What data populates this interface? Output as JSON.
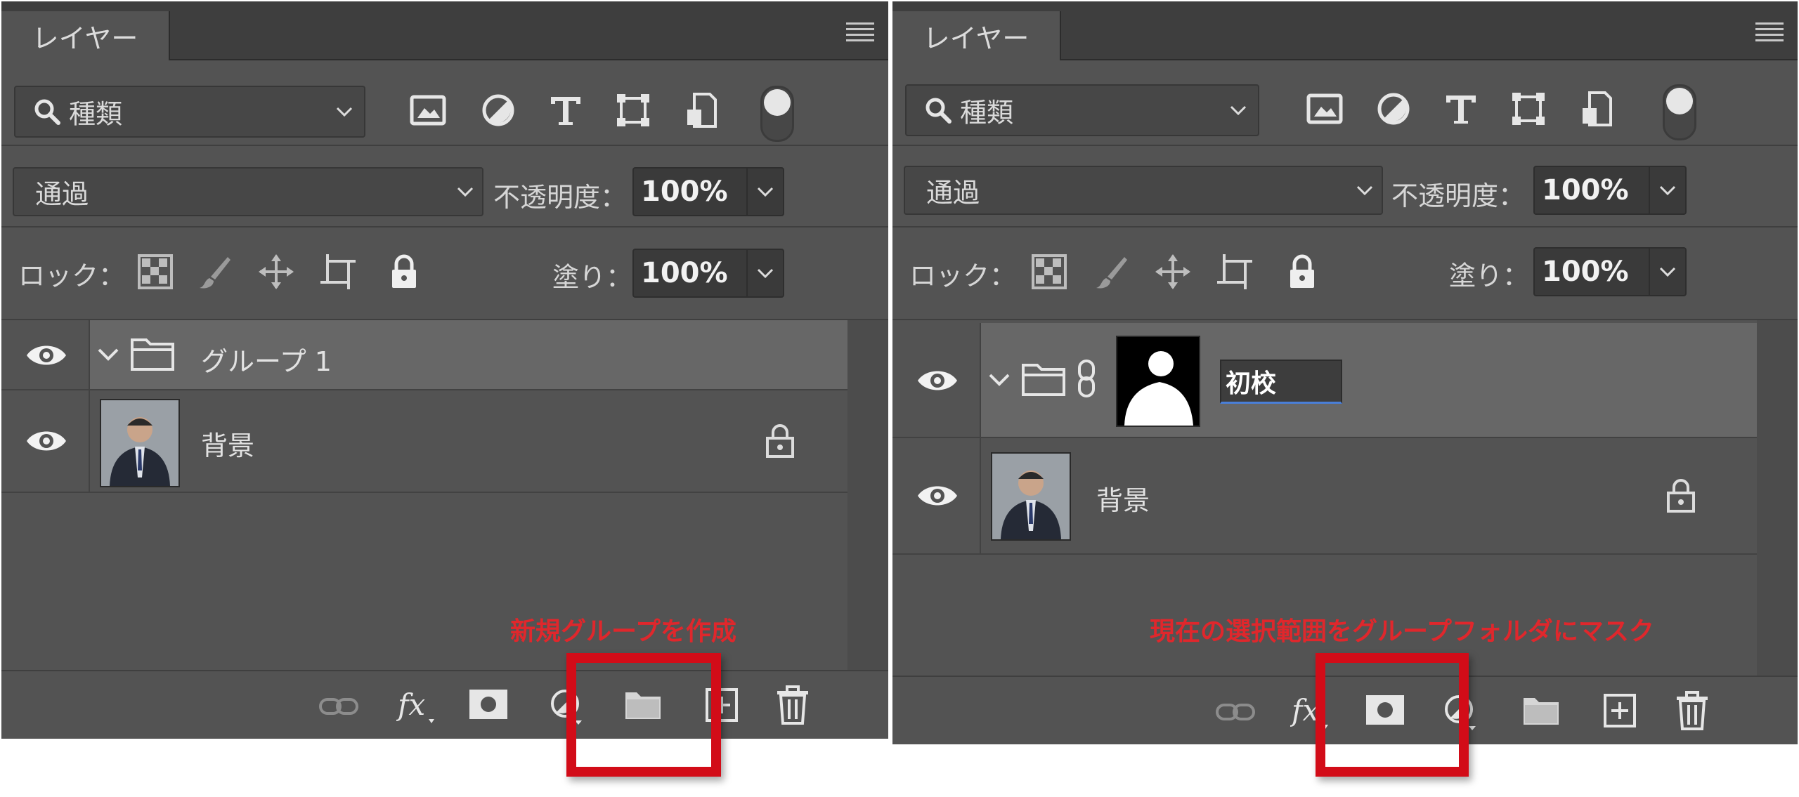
{
  "left_panel": {
    "tab_title": "レイヤー",
    "filter": {
      "label": "種類",
      "icons": [
        "image-filter-icon",
        "adjustment-filter-icon",
        "type-filter-icon",
        "shape-filter-icon",
        "smart-object-filter-icon"
      ]
    },
    "blend_mode": "通過",
    "opacity_label": "不透明度：",
    "opacity_value": "100%",
    "lock_label": "ロック：",
    "fill_label": "塗り：",
    "fill_value": "100%",
    "layers": [
      {
        "name": "グループ 1",
        "type": "group",
        "selected": true
      },
      {
        "name": "背景",
        "type": "background",
        "locked": true
      }
    ],
    "footer_icons": [
      "link-layers-icon",
      "fx-icon",
      "add-mask-icon",
      "adjustment-layer-icon",
      "new-group-icon",
      "new-layer-icon",
      "trash-icon"
    ],
    "annotation": "新規グループを作成"
  },
  "right_panel": {
    "tab_title": "レイヤー",
    "filter": {
      "label": "種類"
    },
    "blend_mode": "通過",
    "opacity_label": "不透明度：",
    "opacity_value": "100%",
    "lock_label": "ロック：",
    "fill_label": "塗り：",
    "fill_value": "100%",
    "layers": [
      {
        "name": "初校",
        "type": "group-with-mask",
        "selected": true,
        "editing": true
      },
      {
        "name": "背景",
        "type": "background",
        "locked": true
      }
    ],
    "footer_icons": [
      "link-layers-icon",
      "fx-icon",
      "add-mask-icon",
      "adjustment-layer-icon",
      "new-group-icon",
      "new-layer-icon",
      "trash-icon"
    ],
    "annotation": "現在の選択範囲をグループフォルダにマスク"
  },
  "colors": {
    "panel_bg": "#535353",
    "selected_row": "#676767",
    "highlight_red": "#d20c18",
    "annotation_red": "#e0272c"
  }
}
